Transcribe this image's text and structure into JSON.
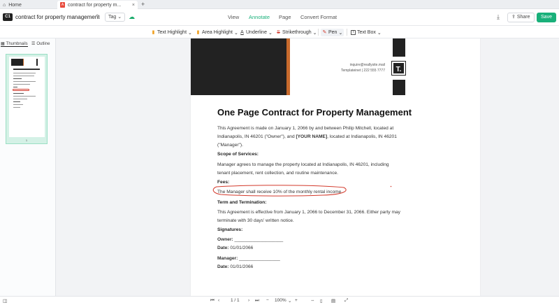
{
  "tabs": {
    "home_label": "Home",
    "doc_label": "contract for property m...",
    "close_glyph": "×",
    "add_glyph": "+"
  },
  "toolbar": {
    "logo_text": "C1",
    "doc_title": "contract for property management",
    "tag_label": "Tag ⌄",
    "main_tabs": [
      "View",
      "Annotate",
      "Page",
      "Convert Format"
    ],
    "active_tab": "Annotate",
    "share_label": "Share",
    "save_label": "Save"
  },
  "annotate_tools": [
    {
      "label": "Text Highlight",
      "icon": "text-highlight-icon",
      "glyph": "▮",
      "color": "#f0a020"
    },
    {
      "label": "Area Highlight",
      "icon": "area-highlight-icon",
      "glyph": "▮",
      "color": "#f0a020"
    },
    {
      "label": "Underline",
      "icon": "underline-icon",
      "glyph": "A",
      "color": "#333333"
    },
    {
      "label": "Strikethrough",
      "icon": "strikethrough-icon",
      "glyph": "S",
      "color": "#d33a2c"
    },
    {
      "label": "Pen",
      "icon": "pen-icon",
      "glyph": "✎",
      "color": "#d33a2c"
    },
    {
      "label": "Text Box",
      "icon": "text-box-icon",
      "glyph": "T",
      "color": "#333333"
    }
  ],
  "sidebar": {
    "tab_thumbnails": "Thumbnails",
    "tab_outline": "Outline",
    "page_number": "1"
  },
  "document": {
    "email": "inquire@reallysite.mail",
    "phone": "Templateinet | 222 555 7777",
    "logo_letter": "T.",
    "heading": "One Page Contract for Property Management",
    "intro_pre": "This Agreement is made on January 1, 2066 by and between Philip Mitchell, located at Indianapolis, IN 46201 (\"Owner\"), and ",
    "intro_bold": "[YOUR NAME]",
    "intro_post": ", located at Indianapolis, IN 46201 (\"Manager\").",
    "scope_heading": "Scope of Services:",
    "scope_text": "Manager agrees to manage the property located at Indianapolis, IN 46201, including tenant placement, rent collection, and routine maintenance.",
    "fees_heading": "Fees:",
    "fees_text": "The Manager shall receive 10% of the monthly rental income.",
    "term_heading": "Term and Termination:",
    "term_text": "This Agreement is effective from January 1, 2066 to December 31, 2066. Either party may terminate with 30 days' written notice.",
    "signatures_heading": "Signatures:",
    "owner_label": "Owner:",
    "owner_line": " ___________________",
    "date_label": "Date:",
    "owner_date": " 01/01/2066",
    "manager_label": "Manager:",
    "manager_line": " ________________",
    "manager_date": " 01/01/2066"
  },
  "statusbar": {
    "page_indicator": "1 / 1",
    "zoom": "100%",
    "zoom_suffix": "⌄"
  },
  "colors": {
    "accent": "#19b07a",
    "annotation_red": "#d33a2c",
    "header_orange": "#c86a2c"
  }
}
